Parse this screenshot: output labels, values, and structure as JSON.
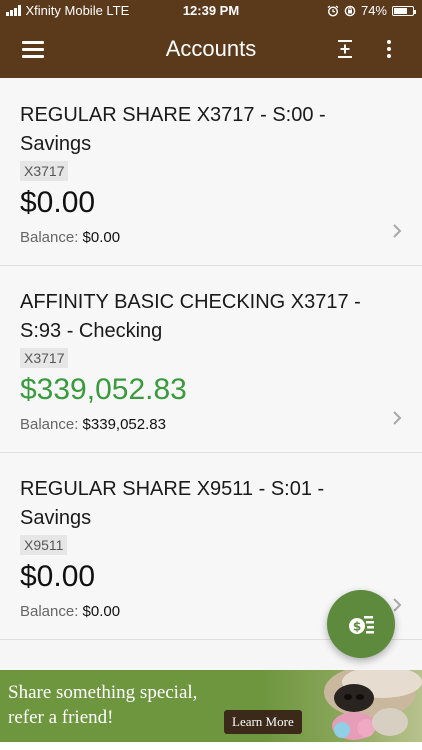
{
  "status_bar": {
    "carrier": "Xfinity Mobile LTE",
    "time": "12:39 PM",
    "battery": "74%",
    "battery_level": 0.74
  },
  "header": {
    "title": "Accounts"
  },
  "accounts": [
    {
      "name": "REGULAR SHARE X3717 - S:00 - Savings",
      "id": "X3717",
      "amount": "$0.00",
      "balance_label": "Balance:",
      "balance": "$0.00"
    },
    {
      "name": "AFFINITY BASIC CHECKING X3717 - S:93 - Checking",
      "id": "X3717",
      "amount": "$339,052.83",
      "balance_label": "Balance:",
      "balance": "$339,052.83"
    },
    {
      "name": "REGULAR SHARE X9511 - S:01 - Savings",
      "id": "X9511",
      "amount": "$0.00",
      "balance_label": "Balance:",
      "balance": "$0.00"
    }
  ],
  "banner": {
    "line1": "Share something special,",
    "line2": "refer a friend!",
    "button": "Learn More"
  },
  "colors": {
    "header_bg": "#5b3a1c",
    "positive_amount": "#3a9a3e",
    "fab_bg": "#5d8a3c",
    "banner_bg": "#6d963f"
  },
  "icons": [
    "menu-icon",
    "expand-icon",
    "kebab-icon",
    "chevron-right-icon",
    "transfer-money-icon",
    "alarm-icon",
    "lock-rotation-icon",
    "battery-icon",
    "signal-icon"
  ]
}
